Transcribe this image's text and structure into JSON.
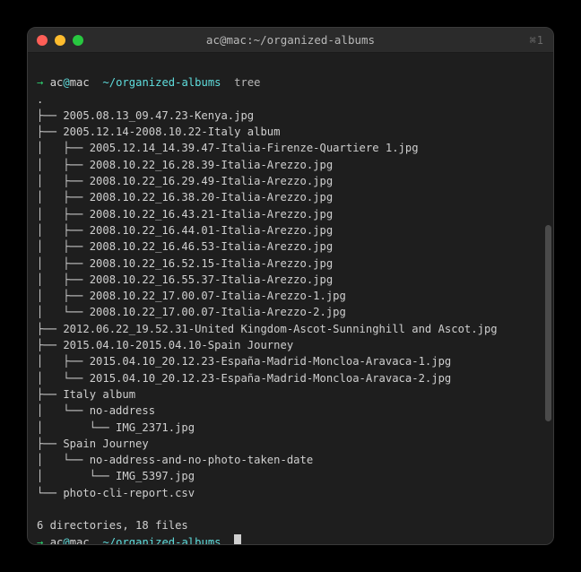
{
  "titlebar": {
    "title": "ac@mac:~/organized-albums",
    "right_indicator": "⌘1"
  },
  "prompt1": {
    "arrow": "→",
    "user": "ac",
    "at": "@",
    "host": "mac",
    "path": " ~/organized-albums ",
    "command": " tree"
  },
  "tree_root": ".",
  "tree_lines": [
    "├── 2005.08.13_09.47.23-Kenya.jpg",
    "├── 2005.12.14-2008.10.22-Italy album",
    "│   ├── 2005.12.14_14.39.47-Italia-Firenze-Quartiere 1.jpg",
    "│   ├── 2008.10.22_16.28.39-Italia-Arezzo.jpg",
    "│   ├── 2008.10.22_16.29.49-Italia-Arezzo.jpg",
    "│   ├── 2008.10.22_16.38.20-Italia-Arezzo.jpg",
    "│   ├── 2008.10.22_16.43.21-Italia-Arezzo.jpg",
    "│   ├── 2008.10.22_16.44.01-Italia-Arezzo.jpg",
    "│   ├── 2008.10.22_16.46.53-Italia-Arezzo.jpg",
    "│   ├── 2008.10.22_16.52.15-Italia-Arezzo.jpg",
    "│   ├── 2008.10.22_16.55.37-Italia-Arezzo.jpg",
    "│   ├── 2008.10.22_17.00.07-Italia-Arezzo-1.jpg",
    "│   └── 2008.10.22_17.00.07-Italia-Arezzo-2.jpg",
    "├── 2012.06.22_19.52.31-United Kingdom-Ascot-Sunninghill and Ascot.jpg",
    "├── 2015.04.10-2015.04.10-Spain Journey",
    "│   ├── 2015.04.10_20.12.23-España-Madrid-Moncloa-Aravaca-1.jpg",
    "│   └── 2015.04.10_20.12.23-España-Madrid-Moncloa-Aravaca-2.jpg",
    "├── Italy album",
    "│   └── no-address",
    "│       └── IMG_2371.jpg",
    "├── Spain Journey",
    "│   └── no-address-and-no-photo-taken-date",
    "│       └── IMG_5397.jpg",
    "└── photo-cli-report.csv"
  ],
  "summary": "6 directories, 18 files",
  "prompt2": {
    "arrow": "→",
    "user": "ac",
    "at": "@",
    "host": "mac",
    "path": " ~/organized-albums "
  }
}
